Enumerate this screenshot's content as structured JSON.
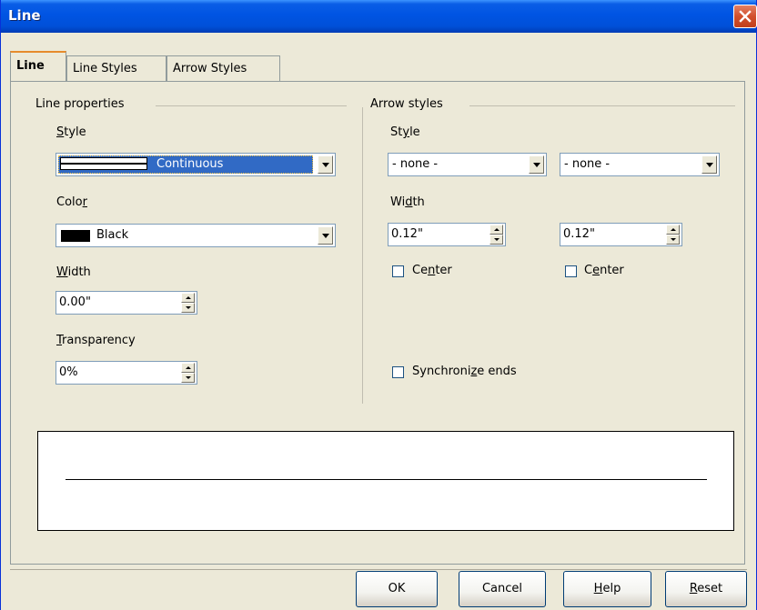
{
  "window": {
    "title": "Line"
  },
  "tabs": [
    {
      "label": "Line",
      "active": true
    },
    {
      "label": "Line Styles",
      "active": false
    },
    {
      "label": "Arrow Styles",
      "active": false
    }
  ],
  "line_properties": {
    "heading": "Line properties",
    "style": {
      "label_pre": "",
      "label_u": "S",
      "label_post": "tyle",
      "value": "Continuous"
    },
    "color": {
      "label_pre": "Colo",
      "label_u": "r",
      "label_post": "",
      "value": "Black",
      "swatch": "#000000"
    },
    "width": {
      "label_pre": "",
      "label_u": "W",
      "label_post": "idth",
      "value": "0.00\""
    },
    "transparency": {
      "label_pre": "",
      "label_u": "T",
      "label_post": "ransparency",
      "value": "0%"
    }
  },
  "arrow_styles": {
    "heading": "Arrow styles",
    "style": {
      "label_pre": "St",
      "label_u": "y",
      "label_post": "le",
      "start_value": "- none -",
      "end_value": "- none -"
    },
    "width": {
      "label_pre": "Wi",
      "label_u": "d",
      "label_post": "th",
      "start_value": "0.12\"",
      "end_value": "0.12\""
    },
    "center_start": {
      "label_pre": "Ce",
      "label_u": "n",
      "label_post": "ter",
      "checked": false
    },
    "center_end": {
      "label_pre": "C",
      "label_u": "e",
      "label_post": "nter",
      "checked": false
    },
    "synchronize": {
      "label_pre": "Synchroni",
      "label_u": "z",
      "label_post": "e ends",
      "checked": false
    }
  },
  "buttons": {
    "ok": "OK",
    "cancel": "Cancel",
    "help_u": "H",
    "help_post": "elp",
    "reset_u": "R",
    "reset_post": "eset"
  },
  "colors": {
    "titlebar": "#0054e3",
    "selection": "#316ac5",
    "dialog_bg": "#ece9d8",
    "close": "#d24f2c"
  }
}
